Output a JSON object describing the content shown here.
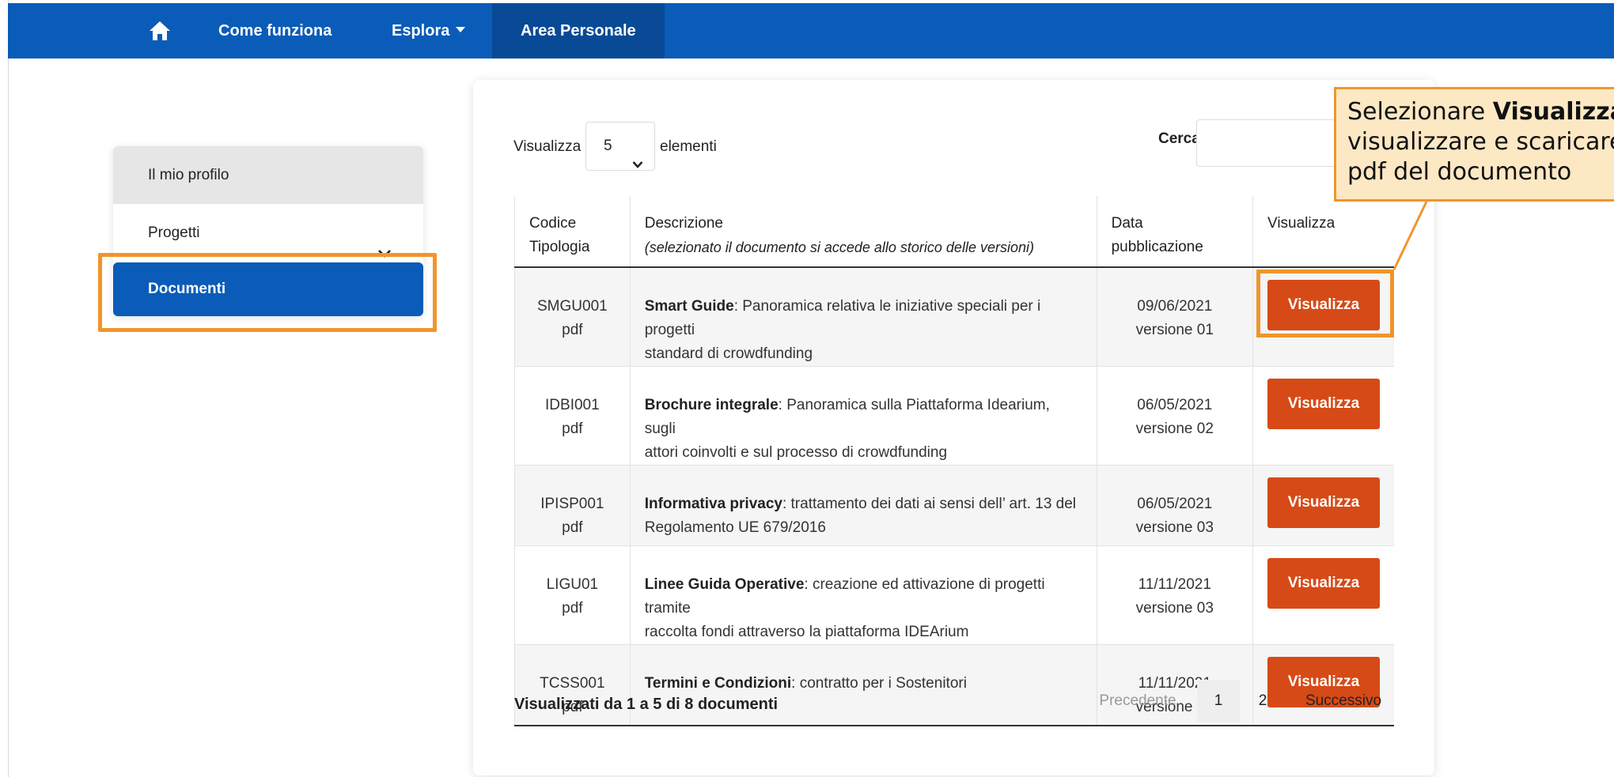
{
  "navbar": {
    "home_icon": "home-icon",
    "items": [
      {
        "label": "Come funziona"
      },
      {
        "label": "Esplora"
      },
      {
        "label": "Area Personale"
      }
    ]
  },
  "sidebar": {
    "items": [
      {
        "label": "Il mio profilo"
      },
      {
        "label": "Progetti"
      },
      {
        "label": "Documenti"
      }
    ]
  },
  "table_controls": {
    "length_label_before": "Visualizza",
    "length_value": "5",
    "length_label_after": "elementi",
    "search_label": "Cerca:",
    "search_value": ""
  },
  "table": {
    "headers": {
      "code_line1": "Codice",
      "code_line2": "Tipologia",
      "desc_title": "Descrizione",
      "desc_sub": "(selezionato il documento si accede allo storico delle versioni)",
      "date_line1": "Data",
      "date_line2": "pubblicazione",
      "view": "Visualizza"
    },
    "rows": [
      {
        "code": "SMGU001",
        "type": "pdf",
        "title": "Smart Guide",
        "desc_line1": ": Panoramica relativa le iniziative speciali per i progetti",
        "desc_line2": "standard di crowdfunding",
        "date": "09/06/2021",
        "version": "versione 01",
        "button": "Visualizza"
      },
      {
        "code": "IDBI001",
        "type": "pdf",
        "title": "Brochure integrale",
        "desc_line1": ": Panoramica sulla Piattaforma Idearium, sugli",
        "desc_line2": "attori coinvolti e sul processo di crowdfunding",
        "date": "06/05/2021",
        "version": "versione 02",
        "button": "Visualizza"
      },
      {
        "code": "IPISP001",
        "type": "pdf",
        "title": "Informativa privacy",
        "desc_line1": ": trattamento dei dati ai sensi dell’ art. 13 del",
        "desc_line2": "Regolamento UE 679/2016",
        "date": "06/05/2021",
        "version": "versione 03",
        "button": "Visualizza"
      },
      {
        "code": "LIGU01",
        "type": "pdf",
        "title": "Linee Guida Operative",
        "desc_line1": ": creazione ed attivazione di progetti tramite",
        "desc_line2": "raccolta fondi attraverso la piattaforma IDEArium",
        "date": "11/11/2021",
        "version": "versione 03",
        "button": "Visualizza"
      },
      {
        "code": "TCSS001",
        "type": "pdf",
        "title": "Termini e Condizioni",
        "desc_line1": ": contratto per i Sostenitori",
        "desc_line2": "",
        "date": "11/11/2021",
        "version": "versione 04",
        "button": "Visualizza"
      }
    ]
  },
  "footer": {
    "info": "Visualizzati da 1 a 5 di 8 documenti",
    "prev": "Precedente",
    "page1": "1",
    "page2": "2",
    "next": "Successivo"
  },
  "callout": {
    "line1_prefix": "Selezionare ",
    "line1_bold": "Visualizza",
    "line2": "visualizzare e scaricare",
    "line3": "pdf del documento"
  },
  "colors": {
    "nav_blue": "#0a5cb8",
    "button_orange": "#d64a17",
    "highlight_orange": "#f0952c",
    "callout_bg": "#fde8c4"
  }
}
